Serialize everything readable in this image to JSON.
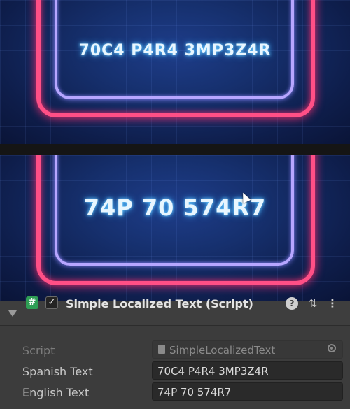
{
  "preview_top": {
    "text": "70C4 P4R4 3MP3Z4R"
  },
  "preview_bottom": {
    "text": "74P 70 574R7"
  },
  "inspector": {
    "component": {
      "icon_glyph": "#",
      "enabled_glyph": "✓",
      "title": "Simple Localized Text (Script)",
      "help_glyph": "?",
      "settings_glyph": "⇅",
      "more_glyph": "⋮"
    },
    "fields": {
      "script": {
        "label": "Script",
        "value": "SimpleLocalizedText"
      },
      "spanish": {
        "label": "Spanish Text",
        "value": "70C4 P4R4 3MP3Z4R"
      },
      "english": {
        "label": "English Text",
        "value": "74P 70 574R7"
      }
    }
  },
  "colors": {
    "neon_pink": "#ff4f86",
    "neon_violet": "#b7a6ff",
    "background_blue": "#16306e",
    "text_glow": "#6fd0ff"
  }
}
